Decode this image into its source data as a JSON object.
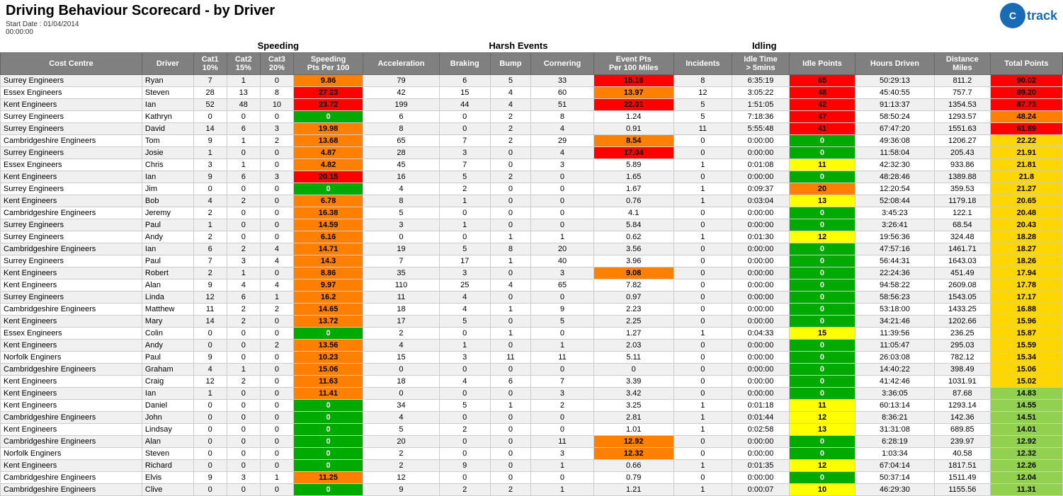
{
  "title": "Driving Behaviour Scorecard - by Driver",
  "startDate": "Start Date : 01/04/2014",
  "startTime": "00:00:00",
  "logo": {
    "symbol": "C",
    "text": "track"
  },
  "sections": {
    "speeding": "Speeding",
    "harshEvents": "Harsh Events",
    "idling": "Idling"
  },
  "columns": [
    "Cost Centre",
    "Driver",
    "Cat1 10%",
    "Cat2 15%",
    "Cat3 20%",
    "Speeding Pts Per 100",
    "Acceleration",
    "Braking",
    "Bump",
    "Cornering",
    "Event Pts Per 100 Miles",
    "Incidents",
    "Idle Time > 5mins",
    "Idle Points",
    "Hours Driven",
    "Distance Miles",
    "Total Points"
  ],
  "rows": [
    [
      "Surrey Engineers",
      "Ryan",
      "7",
      "1",
      "0",
      "9.86",
      "79",
      "6",
      "5",
      "33",
      "15.16",
      "8",
      "6:35:19",
      "65",
      "50:29:13",
      "811.2",
      "90.02"
    ],
    [
      "Essex Engineers",
      "Steven",
      "28",
      "13",
      "8",
      "27.23",
      "42",
      "15",
      "4",
      "60",
      "13.97",
      "12",
      "3:05:22",
      "48",
      "45:40:55",
      "757.7",
      "89.20"
    ],
    [
      "Kent Engineers",
      "Ian",
      "52",
      "48",
      "10",
      "23.72",
      "199",
      "44",
      "4",
      "51",
      "22.01",
      "5",
      "1:51:05",
      "42",
      "91:13:37",
      "1354.53",
      "87.73"
    ],
    [
      "Surrey Engineers",
      "Kathryn",
      "0",
      "0",
      "0",
      "0",
      "6",
      "0",
      "2",
      "8",
      "1.24",
      "5",
      "7:18:36",
      "47",
      "58:50:24",
      "1293.57",
      "48.24"
    ],
    [
      "Surrey Engineers",
      "David",
      "14",
      "6",
      "3",
      "19.98",
      "8",
      "0",
      "2",
      "4",
      "0.91",
      "11",
      "5:55:48",
      "41",
      "67:47:20",
      "1551.63",
      "61.89"
    ],
    [
      "Cambridgeshire Engineers",
      "Tom",
      "9",
      "1",
      "2",
      "13.68",
      "65",
      "7",
      "2",
      "29",
      "8.54",
      "0",
      "0:00:00",
      "0",
      "49:36:08",
      "1206.27",
      "22.22"
    ],
    [
      "Surrey Engineers",
      "Josie",
      "1",
      "0",
      "0",
      "4.87",
      "28",
      "3",
      "0",
      "4",
      "17.04",
      "0",
      "0:00:00",
      "0",
      "11:58:04",
      "205.43",
      "21.91"
    ],
    [
      "Essex Engineers",
      "Chris",
      "3",
      "1",
      "0",
      "4.82",
      "45",
      "7",
      "0",
      "3",
      "5.89",
      "1",
      "0:01:08",
      "11",
      "42:32:30",
      "933.86",
      "21.81"
    ],
    [
      "Kent Engineers",
      "Ian",
      "9",
      "6",
      "3",
      "20.15",
      "16",
      "5",
      "2",
      "0",
      "1.65",
      "0",
      "0:00:00",
      "0",
      "48:28:46",
      "1389.88",
      "21.8"
    ],
    [
      "Surrey Engineers",
      "Jim",
      "0",
      "0",
      "0",
      "0",
      "4",
      "2",
      "0",
      "0",
      "1.67",
      "1",
      "0:09:37",
      "20",
      "12:20:54",
      "359.53",
      "21.27"
    ],
    [
      "Kent Engineers",
      "Bob",
      "4",
      "2",
      "0",
      "6.78",
      "8",
      "1",
      "0",
      "0",
      "0.76",
      "1",
      "0:03:04",
      "13",
      "52:08:44",
      "1179.18",
      "20.65"
    ],
    [
      "Cambridgeshire Engineers",
      "Jeremy",
      "2",
      "0",
      "0",
      "16.38",
      "5",
      "0",
      "0",
      "0",
      "4.1",
      "0",
      "0:00:00",
      "0",
      "3:45:23",
      "122.1",
      "20.48"
    ],
    [
      "Surrey Engineers",
      "Paul",
      "1",
      "0",
      "0",
      "14.59",
      "3",
      "1",
      "0",
      "0",
      "5.84",
      "0",
      "0:00:00",
      "0",
      "3:26:41",
      "68.54",
      "20.43"
    ],
    [
      "Surrey Engineers",
      "Andy",
      "2",
      "0",
      "0",
      "6.16",
      "0",
      "0",
      "1",
      "1",
      "0.62",
      "1",
      "0:01:30",
      "12",
      "19:56:36",
      "324.48",
      "18.28"
    ],
    [
      "Cambridgeshire Engineers",
      "Ian",
      "6",
      "2",
      "4",
      "14.71",
      "19",
      "5",
      "8",
      "20",
      "3.56",
      "0",
      "0:00:00",
      "0",
      "47:57:16",
      "1461.71",
      "18.27"
    ],
    [
      "Surrey Engineers",
      "Paul",
      "7",
      "3",
      "4",
      "14.3",
      "7",
      "17",
      "1",
      "40",
      "3.96",
      "0",
      "0:00:00",
      "0",
      "56:44:31",
      "1643.03",
      "18.26"
    ],
    [
      "Kent Engineers",
      "Robert",
      "2",
      "1",
      "0",
      "8.86",
      "35",
      "3",
      "0",
      "3",
      "9.08",
      "0",
      "0:00:00",
      "0",
      "22:24:36",
      "451.49",
      "17.94"
    ],
    [
      "Kent Engineers",
      "Alan",
      "9",
      "4",
      "4",
      "9.97",
      "110",
      "25",
      "4",
      "65",
      "7.82",
      "0",
      "0:00:00",
      "0",
      "94:58:22",
      "2609.08",
      "17.78"
    ],
    [
      "Surrey Engineers",
      "Linda",
      "12",
      "6",
      "1",
      "16.2",
      "11",
      "4",
      "0",
      "0",
      "0.97",
      "0",
      "0:00:00",
      "0",
      "58:56:23",
      "1543.05",
      "17.17"
    ],
    [
      "Cambridgeshire Engineers",
      "Matthew",
      "11",
      "2",
      "2",
      "14.65",
      "18",
      "4",
      "1",
      "9",
      "2.23",
      "0",
      "0:00:00",
      "0",
      "53:18:00",
      "1433.25",
      "16.88"
    ],
    [
      "Kent Engineers",
      "Mary",
      "14",
      "2",
      "0",
      "13.72",
      "17",
      "5",
      "0",
      "5",
      "2.25",
      "0",
      "0:00:00",
      "0",
      "34:21:46",
      "1202.66",
      "15.96"
    ],
    [
      "Essex Engineers",
      "Colin",
      "0",
      "0",
      "0",
      "0",
      "2",
      "0",
      "1",
      "0",
      "1.27",
      "1",
      "0:04:33",
      "15",
      "11:39:56",
      "236.25",
      "15.87"
    ],
    [
      "Kent Engineers",
      "Andy",
      "0",
      "0",
      "2",
      "13.56",
      "4",
      "1",
      "0",
      "1",
      "2.03",
      "0",
      "0:00:00",
      "0",
      "11:05:47",
      "295.03",
      "15.59"
    ],
    [
      "Norfolk Enginers",
      "Paul",
      "9",
      "0",
      "0",
      "10.23",
      "15",
      "3",
      "11",
      "11",
      "5.11",
      "0",
      "0:00:00",
      "0",
      "26:03:08",
      "782.12",
      "15.34"
    ],
    [
      "Cambridgeshire Engineers",
      "Graham",
      "4",
      "1",
      "0",
      "15.06",
      "0",
      "0",
      "0",
      "0",
      "0",
      "0",
      "0:00:00",
      "0",
      "14:40:22",
      "398.49",
      "15.06"
    ],
    [
      "Kent Engineers",
      "Craig",
      "12",
      "2",
      "0",
      "11.63",
      "18",
      "4",
      "6",
      "7",
      "3.39",
      "0",
      "0:00:00",
      "0",
      "41:42:46",
      "1031.91",
      "15.02"
    ],
    [
      "Kent Engineers",
      "Ian",
      "1",
      "0",
      "0",
      "11.41",
      "0",
      "0",
      "0",
      "3",
      "3.42",
      "0",
      "0:00:00",
      "0",
      "3:36:05",
      "87.68",
      "14.83"
    ],
    [
      "Kent Engineers",
      "Daniel",
      "0",
      "0",
      "0",
      "0",
      "34",
      "5",
      "1",
      "2",
      "3.25",
      "1",
      "0:01:18",
      "11",
      "60:13:14",
      "1293.14",
      "14.55"
    ],
    [
      "Cambridgeshire Engineers",
      "John",
      "0",
      "0",
      "0",
      "0",
      "4",
      "0",
      "0",
      "0",
      "2.81",
      "1",
      "0:01:44",
      "12",
      "8:36:21",
      "142.36",
      "14.51"
    ],
    [
      "Kent Engineers",
      "Lindsay",
      "0",
      "0",
      "0",
      "0",
      "5",
      "2",
      "0",
      "0",
      "1.01",
      "1",
      "0:02:58",
      "13",
      "31:31:08",
      "689.85",
      "14.01"
    ],
    [
      "Cambridgeshire Engineers",
      "Alan",
      "0",
      "0",
      "0",
      "0",
      "20",
      "0",
      "0",
      "11",
      "12.92",
      "0",
      "0:00:00",
      "0",
      "6:28:19",
      "239.97",
      "12.92"
    ],
    [
      "Norfolk Enginers",
      "Steven",
      "0",
      "0",
      "0",
      "0",
      "2",
      "0",
      "0",
      "3",
      "12.32",
      "0",
      "0:00:00",
      "0",
      "1:03:34",
      "40.58",
      "12.32"
    ],
    [
      "Kent Engineers",
      "Richard",
      "0",
      "0",
      "0",
      "0",
      "2",
      "9",
      "0",
      "1",
      "0.66",
      "1",
      "0:01:35",
      "12",
      "67:04:14",
      "1817.51",
      "12.26"
    ],
    [
      "Cambridgeshire Engineers",
      "Elvis",
      "9",
      "3",
      "1",
      "11.25",
      "12",
      "0",
      "0",
      "0",
      "0.79",
      "0",
      "0:00:00",
      "0",
      "50:37:14",
      "1511.49",
      "12.04"
    ],
    [
      "Cambridgeshire Engineers",
      "Clive",
      "0",
      "0",
      "0",
      "0",
      "9",
      "2",
      "2",
      "1",
      "1.21",
      "1",
      "0:00:07",
      "10",
      "46:29:30",
      "1155.56",
      "11.31"
    ]
  ],
  "colors": {
    "headerBg": "#808080",
    "red": "#ff0000",
    "orange": "#ff8000",
    "green": "#00aa00",
    "yellow": "#ffff00",
    "lightGreen": "#92d050"
  }
}
